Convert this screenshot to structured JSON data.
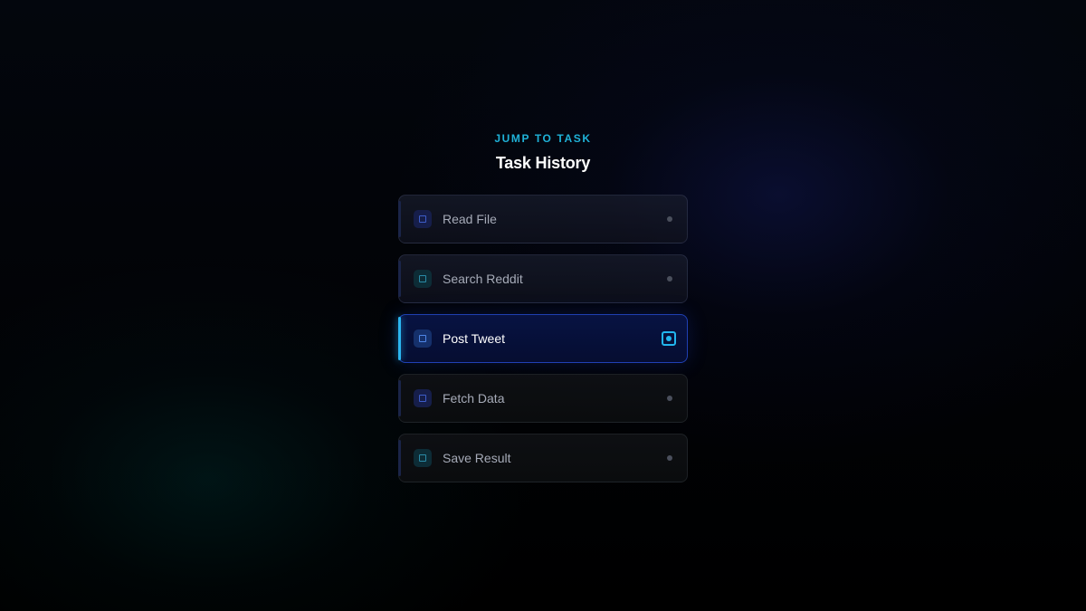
{
  "header": {
    "eyebrow": "JUMP TO TASK",
    "title": "Task History"
  },
  "tasks": [
    {
      "label": "Read File",
      "icon": "file-icon",
      "accent": "blue",
      "state": "inactive"
    },
    {
      "label": "Search Reddit",
      "icon": "search-icon",
      "accent": "teal",
      "state": "inactive"
    },
    {
      "label": "Post Tweet",
      "icon": "send-icon",
      "accent": "blue",
      "state": "active"
    },
    {
      "label": "Fetch Data",
      "icon": "download-icon",
      "accent": "blue",
      "state": "inactive"
    },
    {
      "label": "Save Result",
      "icon": "save-icon",
      "accent": "teal",
      "state": "inactive"
    }
  ],
  "colors": {
    "accent_cyan": "#1fb2d8",
    "active_border": "#2850dc",
    "active_bg": "#08144a",
    "text_muted": "#a6abb8",
    "text_active": "#ffffff"
  }
}
